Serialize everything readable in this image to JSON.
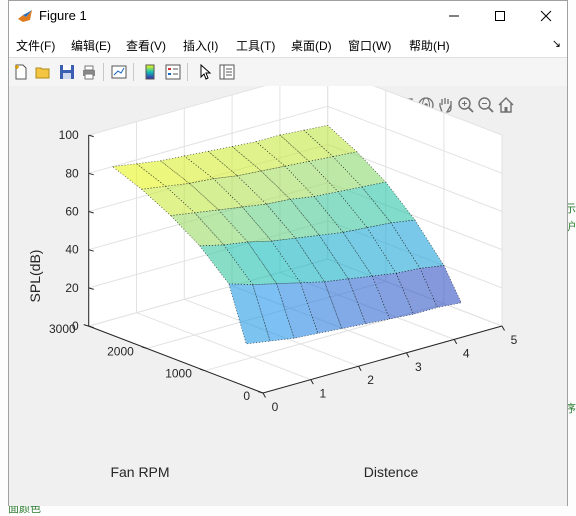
{
  "window": {
    "title": "Figure 1",
    "controls": [
      "minimize",
      "maximize",
      "close"
    ]
  },
  "menu": {
    "items": [
      "文件(F)",
      "编辑(E)",
      "查看(V)",
      "插入(I)",
      "工具(T)",
      "桌面(D)",
      "窗口(W)",
      "帮助(H)"
    ]
  },
  "toolbar": {
    "icons": [
      "new-figure-icon",
      "open-file-icon",
      "save-icon",
      "print-icon",
      "link-plot-icon",
      "colorbar-icon",
      "legend-icon",
      "edit-plot-arrow-icon",
      "property-inspector-icon"
    ]
  },
  "axes_toolbar": {
    "icons": [
      "export-icon",
      "brush-icon",
      "data-tips-icon",
      "rotate-3d-icon",
      "pan-icon",
      "zoom-in-icon",
      "zoom-out-icon",
      "home-icon"
    ]
  },
  "background": {
    "right_fragments": [
      "示",
      "沪",
      "序"
    ],
    "bottom_fragment": "面颜色"
  },
  "chart_data": {
    "type": "surface",
    "title": "",
    "xlabel": "Distence",
    "ylabel": "Fan RPM",
    "zlabel": "SPL(dB)",
    "xlim": [
      0,
      5
    ],
    "ylim": [
      0,
      3000
    ],
    "zlim": [
      0,
      100
    ],
    "x_ticks": [
      "0",
      "1",
      "2",
      "3",
      "4",
      "5"
    ],
    "y_ticks": [
      "0",
      "1000",
      "2000",
      "3000"
    ],
    "z_ticks": [
      "0",
      "20",
      "40",
      "60",
      "80",
      "100"
    ],
    "x": [
      0.5,
      1.0,
      1.5,
      2.0,
      2.5,
      3.0,
      3.5,
      4.0,
      4.5,
      5.0
    ],
    "y": [
      3000,
      2500,
      2000,
      1500,
      1000,
      700
    ],
    "z": [
      [
        80,
        78,
        76,
        75,
        74,
        73,
        72,
        72,
        71,
        70
      ],
      [
        74,
        72,
        70,
        69,
        67,
        66,
        65,
        64,
        63,
        62
      ],
      [
        66,
        64,
        62,
        60,
        58,
        57,
        55,
        54,
        53,
        52
      ],
      [
        56,
        53,
        51,
        48,
        46,
        44,
        42,
        41,
        40,
        38
      ],
      [
        42,
        38,
        35,
        32,
        29,
        27,
        25,
        23,
        22,
        20
      ],
      [
        14,
        12,
        10,
        9,
        8,
        7,
        6,
        5,
        5,
        4
      ]
    ],
    "colormap": "parula",
    "face_alpha": 0.6,
    "edge_style": "dotted",
    "grid": true,
    "box": false
  }
}
